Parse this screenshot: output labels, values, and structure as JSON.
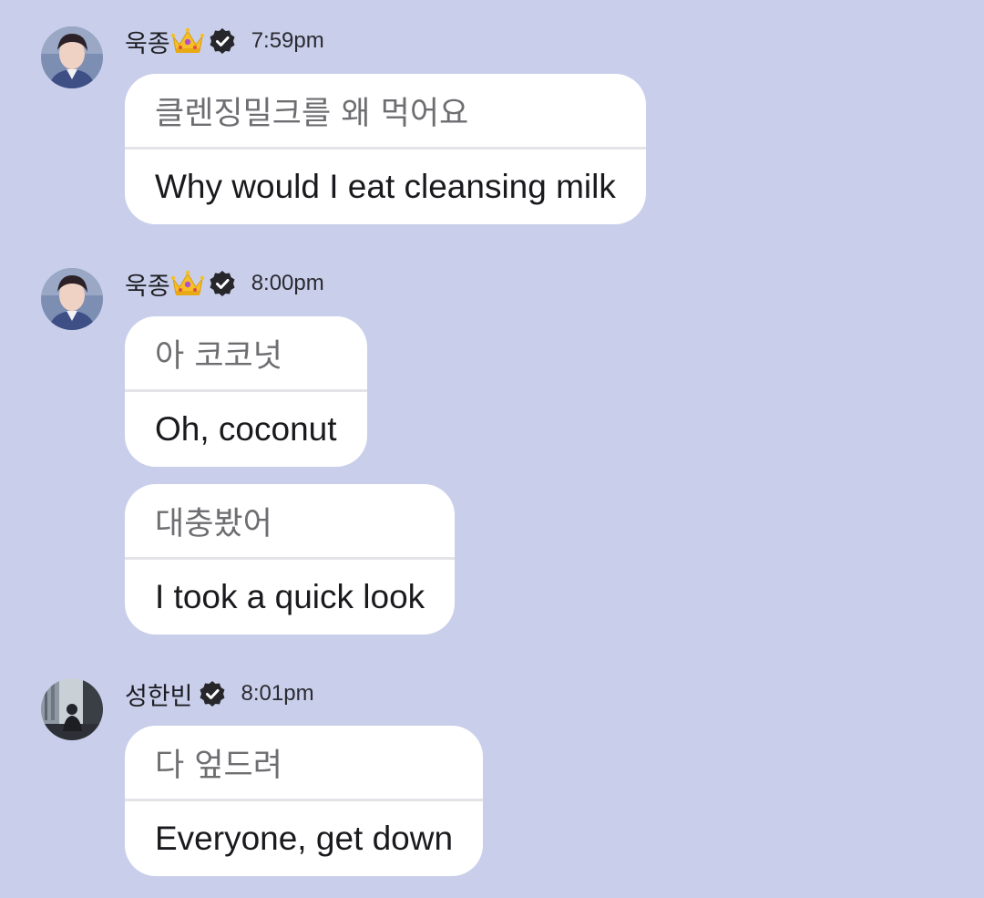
{
  "messages": [
    {
      "sender": "욱종",
      "time": "7:59pm",
      "has_crown": true,
      "avatar": "avatar-1",
      "bubbles": [
        {
          "original": "클렌징밀크를 왜 먹어요",
          "translation": "Why would I eat cleansing milk"
        }
      ]
    },
    {
      "sender": "욱종",
      "time": "8:00pm",
      "has_crown": true,
      "avatar": "avatar-1",
      "bubbles": [
        {
          "original": "아 코코넛",
          "translation": "Oh, coconut"
        },
        {
          "original": "대충봤어",
          "translation": "I took a quick look"
        }
      ]
    },
    {
      "sender": "성한빈",
      "time": "8:01pm",
      "has_crown": false,
      "avatar": "avatar-2",
      "bubbles": [
        {
          "original": "다 엎드려",
          "translation": "Everyone, get down"
        }
      ]
    }
  ],
  "icons": {
    "crown": "crown-emoji-icon",
    "verified": "verified-badge-icon"
  },
  "colors": {
    "background": "#c9cfeb",
    "bubble": "#ffffff",
    "original_text": "#6e6e72",
    "translation_text": "#1a1a1e"
  }
}
